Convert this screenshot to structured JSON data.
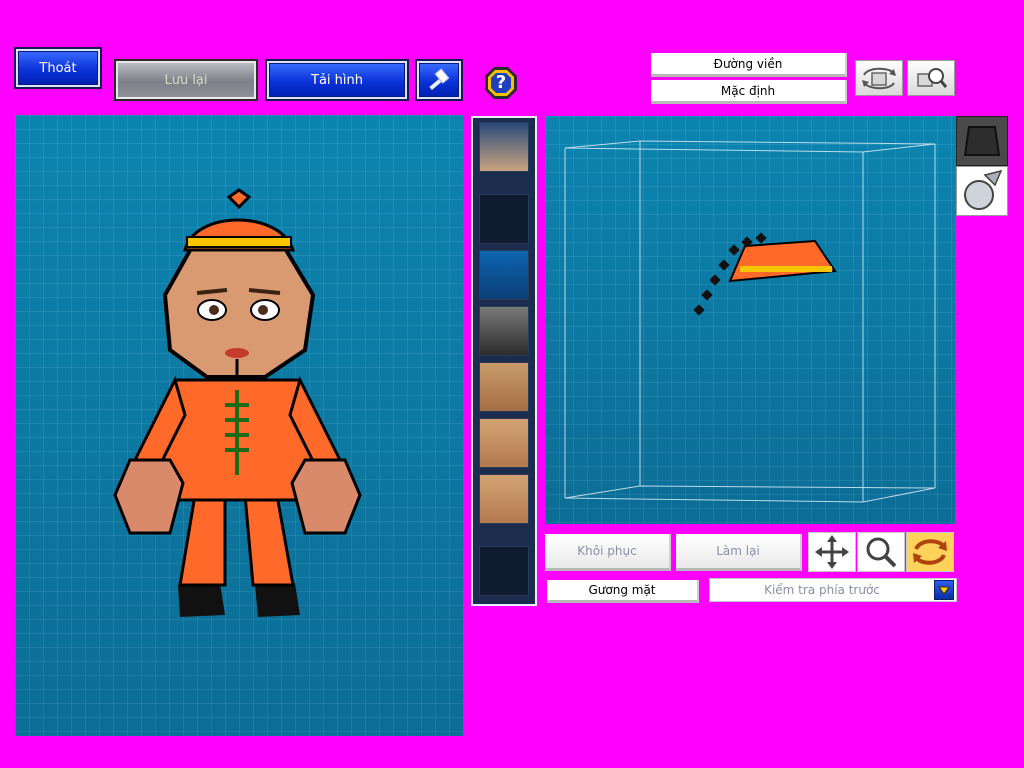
{
  "toolbar": {
    "exit_label": "Thoát",
    "save_label": "Lưu lại",
    "reload_label": "Tải hình",
    "help_glyph": "?"
  },
  "right_toolbar": {
    "outline_label": "Đường viền",
    "default_label": "Mặc định"
  },
  "editor": {
    "restore_label": "Khôi phục",
    "redo_label": "Làm lại",
    "face_label": "Gương mặt",
    "view_select_value": "Kiểm tra phía trước"
  },
  "icons": {
    "exit": "exit-icon",
    "hammer": "hammer-icon",
    "help": "help-icon",
    "rotate_view": "rotate-view-icon",
    "zoom_view": "zoom-view-icon",
    "move": "move-arrows-icon",
    "zoom": "magnifier-icon",
    "rotate": "rotate-icon",
    "dropdown": "chevron-down-icon"
  },
  "colors": {
    "background": "#ff00ff",
    "panel": "#0f7fa6",
    "accent_orange": "#ff6a2b",
    "button_blue": "#1a44e8"
  }
}
